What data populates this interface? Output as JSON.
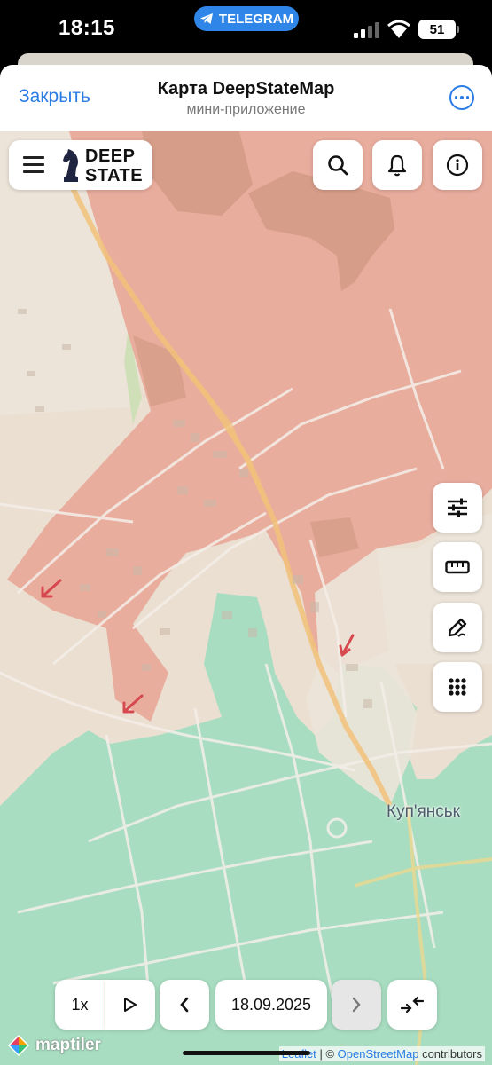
{
  "status_bar": {
    "time": "18:15",
    "telegram_label": "TELEGRAM",
    "battery": "51"
  },
  "header": {
    "close_label": "Закрыть",
    "title": "Карта DeepStateMap",
    "subtitle": "мини-приложение"
  },
  "logo": {
    "line1": "DEEP",
    "line2": "STATE"
  },
  "top_buttons": [
    {
      "name": "search",
      "icon": "search-icon"
    },
    {
      "name": "notifications",
      "icon": "bell-icon"
    },
    {
      "name": "info",
      "icon": "info-icon"
    }
  ],
  "side_tools": [
    {
      "name": "filters",
      "icon": "sliders-icon"
    },
    {
      "name": "ruler",
      "icon": "ruler-icon"
    },
    {
      "name": "draw",
      "icon": "pen-icon"
    },
    {
      "name": "grid",
      "icon": "grid-icon"
    }
  ],
  "map": {
    "place_label": "Куп'янськ",
    "colors": {
      "occupied": "#e8a899",
      "liberated": "#a4dcc0",
      "background": "#ebdfd2",
      "roads": "#f4efe9",
      "highway": "#f1c27a"
    }
  },
  "timeline": {
    "speed": "1x",
    "date": "18.09.2025"
  },
  "attribution": {
    "maptiler": "maptiler",
    "leaflet": "Leaflet",
    "sep": "|",
    "copy": "©",
    "osm": "OpenStreetMap",
    "contributors": "contributors"
  }
}
